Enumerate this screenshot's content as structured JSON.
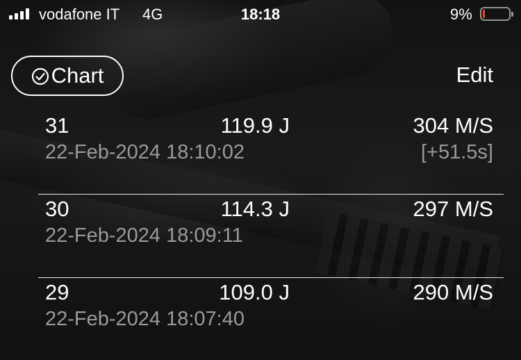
{
  "status_bar": {
    "carrier": "vodafone IT",
    "network": "4G",
    "time": "18:18",
    "battery_percent": "9%",
    "battery_level": 0.09,
    "battery_color": "#ff3b30"
  },
  "nav": {
    "chart_label": "Chart",
    "chart_icon": "checkmark-circle-icon",
    "edit_label": "Edit"
  },
  "shots": [
    {
      "number": "31",
      "energy": "119.9 J",
      "speed": "304 M/S",
      "timestamp": "22-Feb-2024 18:10:02",
      "delta": "[+51.5s]"
    },
    {
      "number": "30",
      "energy": "114.3 J",
      "speed": "297 M/S",
      "timestamp": "22-Feb-2024 18:09:11",
      "delta": ""
    },
    {
      "number": "29",
      "energy": "109.0 J",
      "speed": "290 M/S",
      "timestamp": "22-Feb-2024 18:07:40",
      "delta": ""
    }
  ]
}
